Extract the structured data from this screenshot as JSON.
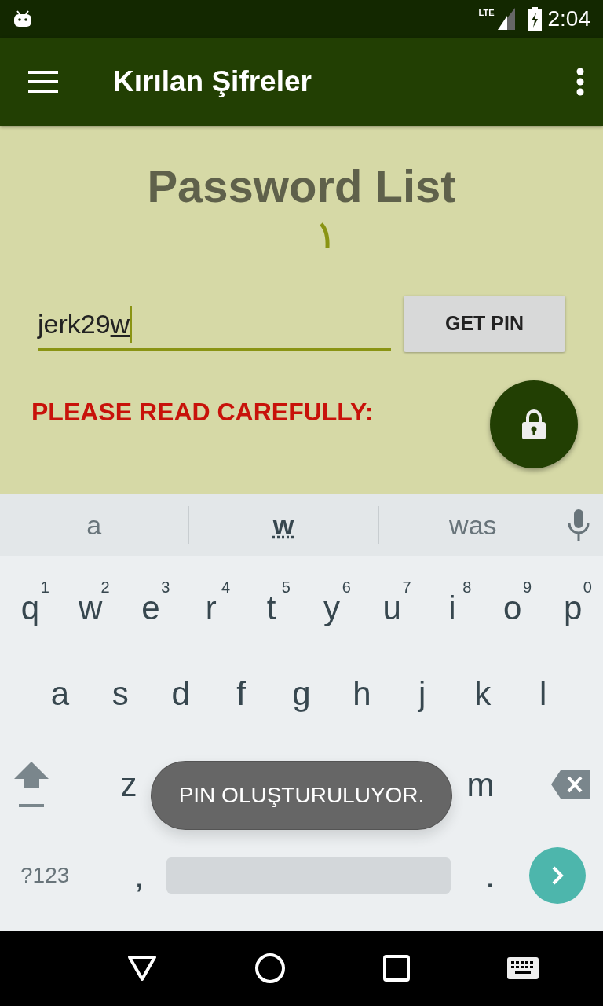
{
  "status_bar": {
    "time": "2:04",
    "network": "LTE"
  },
  "app_bar": {
    "title": "Kırılan Şifreler"
  },
  "content": {
    "heading": "Password List",
    "loading": true,
    "field": {
      "value": "jerk29",
      "composing": "w"
    },
    "button": "GET PIN",
    "warning": "PLEASE READ CAREFULLY:"
  },
  "keyboard": {
    "suggestions": [
      {
        "text": "a",
        "selected": false
      },
      {
        "text": "w",
        "selected": true
      },
      {
        "text": "was",
        "selected": false
      }
    ],
    "row1": [
      {
        "key": "q",
        "hint": "1"
      },
      {
        "key": "w",
        "hint": "2"
      },
      {
        "key": "e",
        "hint": "3"
      },
      {
        "key": "r",
        "hint": "4"
      },
      {
        "key": "t",
        "hint": "5"
      },
      {
        "key": "y",
        "hint": "6"
      },
      {
        "key": "u",
        "hint": "7"
      },
      {
        "key": "i",
        "hint": "8"
      },
      {
        "key": "o",
        "hint": "9"
      },
      {
        "key": "p",
        "hint": "0"
      }
    ],
    "row2": [
      "a",
      "s",
      "d",
      "f",
      "g",
      "h",
      "j",
      "k",
      "l"
    ],
    "row3_left": [
      "z"
    ],
    "row3_right": [
      "m"
    ],
    "symbols_key": "?123",
    "comma": ",",
    "period": "."
  },
  "toast": "PIN OLUŞTURULUYOR."
}
